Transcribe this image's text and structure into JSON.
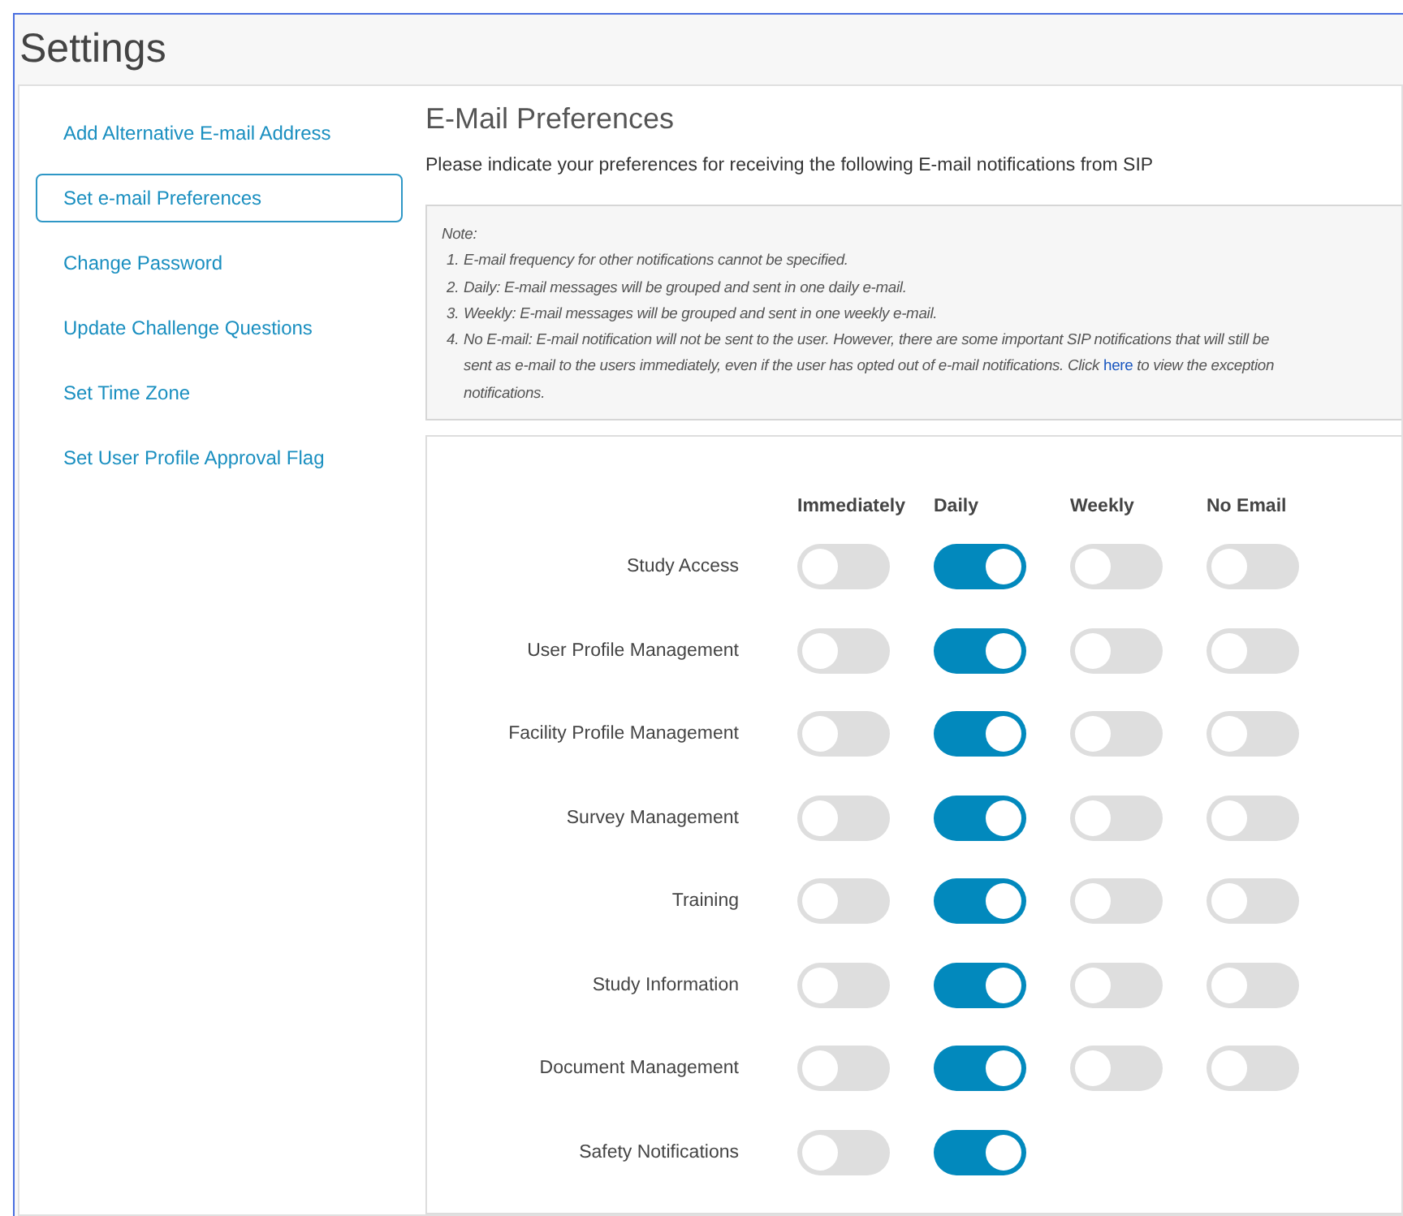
{
  "title": "Settings",
  "sidebar": {
    "items": [
      {
        "label": "Add Alternative E-mail Address",
        "selected": false
      },
      {
        "label": "Set e-mail Preferences",
        "selected": true
      },
      {
        "label": "Change Password",
        "selected": false
      },
      {
        "label": "Update Challenge Questions",
        "selected": false
      },
      {
        "label": "Set Time Zone",
        "selected": false
      },
      {
        "label": "Set User Profile Approval Flag",
        "selected": false
      }
    ]
  },
  "heading": "E-Mail Preferences",
  "intro": "Please indicate your preferences for receiving the following E-mail notifications from SIP",
  "note": {
    "title": "Note:",
    "items": [
      {
        "number": "1.",
        "lines": [
          {
            "text": "E-mail frequency for other notifications cannot be specified."
          }
        ]
      },
      {
        "number": "2.",
        "lines": [
          {
            "text": "Daily: E-mail messages will be grouped and sent in one daily e-mail."
          }
        ]
      },
      {
        "number": "3.",
        "lines": [
          {
            "text": "Weekly: E-mail messages will be grouped and sent in one weekly e-mail."
          }
        ]
      },
      {
        "number": "4.",
        "lines": [
          {
            "text": "No E-mail: E-mail notification will not be sent to the user. However, there are some important SIP notifications that will still be"
          },
          {
            "text": "sent as e-mail to the users immediately, even if the user has opted out of e-mail notifications. Click",
            "link": "here",
            "after": "to view the exception"
          },
          {
            "text": "notifications."
          }
        ]
      }
    ]
  },
  "columns": [
    "Immediately",
    "Daily",
    "Weekly",
    "No Email"
  ],
  "rows": [
    {
      "label": "Study Access",
      "toggles": [
        {
          "on": false
        },
        {
          "on": true
        },
        {
          "on": false
        },
        {
          "on": false
        }
      ]
    },
    {
      "label": "User Profile Management",
      "toggles": [
        {
          "on": false
        },
        {
          "on": true
        },
        {
          "on": false
        },
        {
          "on": false
        }
      ]
    },
    {
      "label": "Facility Profile Management",
      "toggles": [
        {
          "on": false
        },
        {
          "on": true
        },
        {
          "on": false
        },
        {
          "on": false
        }
      ]
    },
    {
      "label": "Survey Management",
      "toggles": [
        {
          "on": false
        },
        {
          "on": true
        },
        {
          "on": false
        },
        {
          "on": false
        }
      ]
    },
    {
      "label": "Training",
      "toggles": [
        {
          "on": false
        },
        {
          "on": true
        },
        {
          "on": false
        },
        {
          "on": false
        }
      ]
    },
    {
      "label": "Study Information",
      "toggles": [
        {
          "on": false
        },
        {
          "on": true
        },
        {
          "on": false
        },
        {
          "on": false
        }
      ]
    },
    {
      "label": "Document Management",
      "toggles": [
        {
          "on": false
        },
        {
          "on": true
        },
        {
          "on": false
        },
        {
          "on": false
        }
      ]
    },
    {
      "label": "Safety Notifications",
      "toggles": [
        {
          "on": false
        },
        {
          "on": true
        }
      ]
    }
  ]
}
